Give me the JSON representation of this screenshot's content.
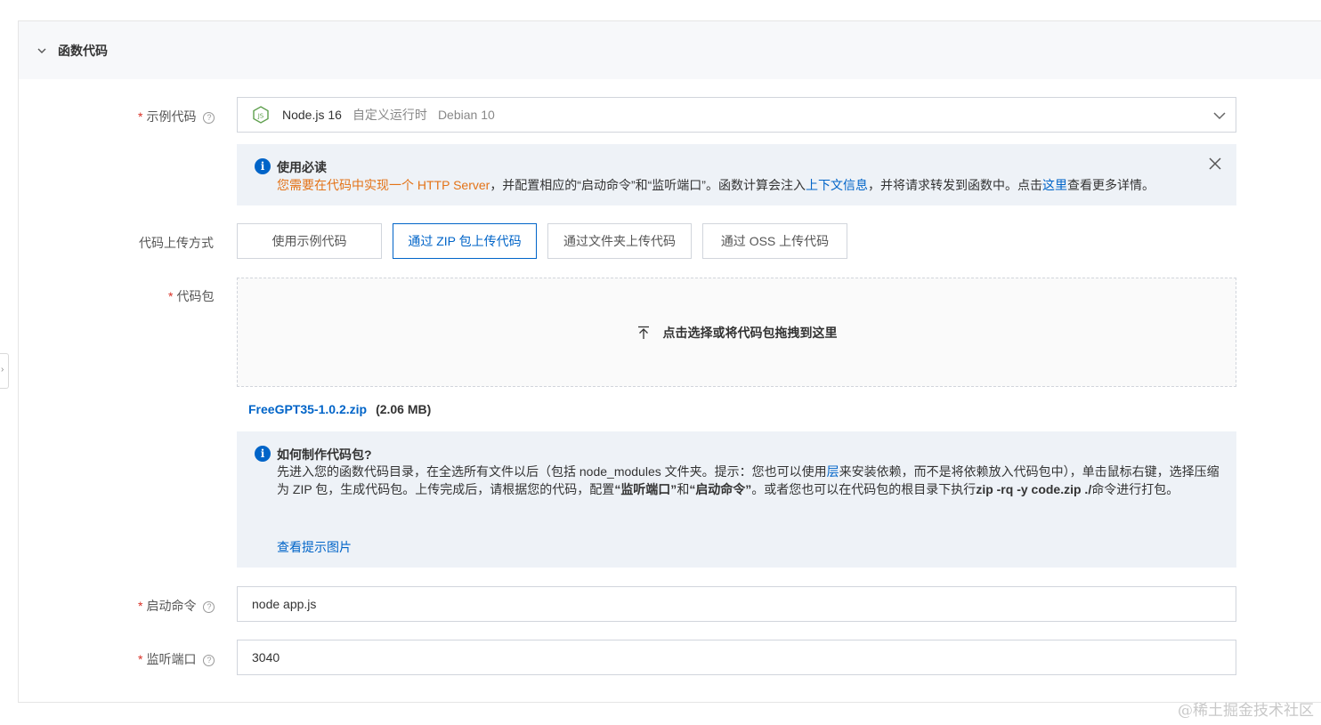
{
  "section": {
    "title": "函数代码"
  },
  "example_code": {
    "label": "示例代码",
    "runtime": "Node.js 16",
    "runtime_type": "自定义运行时",
    "os": "Debian 10"
  },
  "notice": {
    "title": "使用必读",
    "part1": "您需要在代码中实现一个 HTTP Server",
    "part2": "，并配置相应的“启动命令”和“监听端口”。函数计算会注入",
    "link1": "上下文信息",
    "part3": "，并将请求转发到函数中。点击",
    "link2": "这里",
    "part4": "查看更多详情。"
  },
  "upload_method": {
    "label": "代码上传方式",
    "tabs": [
      {
        "label": "使用示例代码",
        "active": false
      },
      {
        "label": "通过 ZIP 包上传代码",
        "active": true
      },
      {
        "label": "通过文件夹上传代码",
        "active": false
      },
      {
        "label": "通过 OSS 上传代码",
        "active": false
      }
    ]
  },
  "code_package": {
    "label": "代码包",
    "dropzone_text": "点击选择或将代码包拖拽到这里",
    "file_name": "FreeGPT35-1.0.2.zip",
    "file_size": "(2.06 MB)"
  },
  "help": {
    "title": "如何制作代码包?",
    "s1": "先进入您的函数代码目录，在全选所有文件以后（包括 node_modules 文件夹。提示：您也可以使用",
    "s1_link": "层",
    "s2": "来安装依赖，而不是将依赖放入代码包中），单击鼠标右键，选择压缩为 ZIP 包，生成代码包。上传完成后，请根据您的代码，配置",
    "b1": "“监听端口”",
    "s3": "和",
    "b2": "“启动命令”",
    "s4": "。或者您也可以在代码包的根目录下执行",
    "b3": "zip -rq -y code.zip ./",
    "s5": "命令进行打包。",
    "link": "查看提示图片"
  },
  "start_command": {
    "label": "启动命令",
    "value": "node app.js"
  },
  "listen_port": {
    "label": "监听端口",
    "value": "3040"
  },
  "watermark": "@稀土掘金技术社区",
  "colors": {
    "primary": "#0064c8",
    "warning": "#e37318",
    "required": "#d93026"
  }
}
